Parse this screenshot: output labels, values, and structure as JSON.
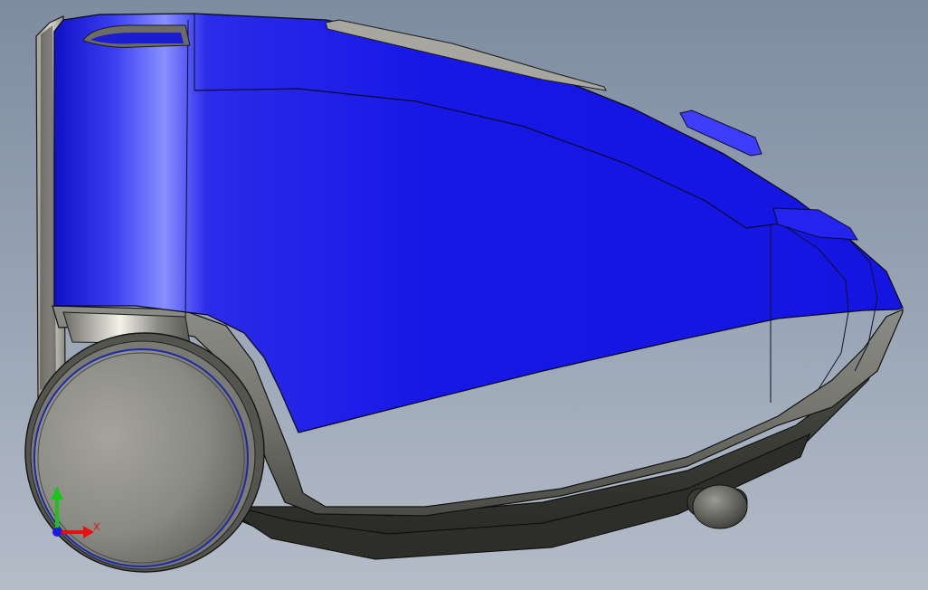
{
  "viewport": {
    "background_top": "#7e8ca0",
    "background_bottom": "#b4bcc8"
  },
  "model": {
    "body_color": "#1a1ae6",
    "body_highlight": "#7f86ff",
    "shell_color": "#7d7d7a",
    "edge_color": "#0a0a14",
    "wheel_ring_color": "#1d2aa8"
  },
  "triad": {
    "x_label": "X",
    "y_label": "Y",
    "x_color": "#e81010",
    "y_color": "#18c418",
    "origin_color": "#1a1ae6"
  }
}
